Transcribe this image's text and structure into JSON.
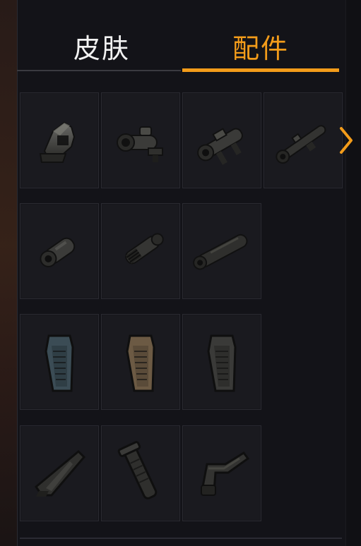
{
  "tabs": {
    "skin_label": "皮肤",
    "parts_label": "配件",
    "active_color": "#f39c1a"
  },
  "attachments": {
    "rows": [
      {
        "row_name": "optics",
        "items": [
          "holographic-sight-icon",
          "acog-scope-icon",
          "red-dot-scope-icon",
          "sniper-scope-icon"
        ]
      },
      {
        "row_name": "muzzle",
        "items": [
          "compensator-icon",
          "flash-hider-icon",
          "suppressor-icon"
        ]
      },
      {
        "row_name": "magazine",
        "items": [
          "magazine-blue-icon",
          "magazine-tan-icon",
          "magazine-dark-icon"
        ]
      },
      {
        "row_name": "grip-stock",
        "items": [
          "angled-grip-icon",
          "vertical-grip-icon",
          "stock-icon"
        ]
      }
    ]
  },
  "next_arrow_icon": "chevron-right-icon"
}
